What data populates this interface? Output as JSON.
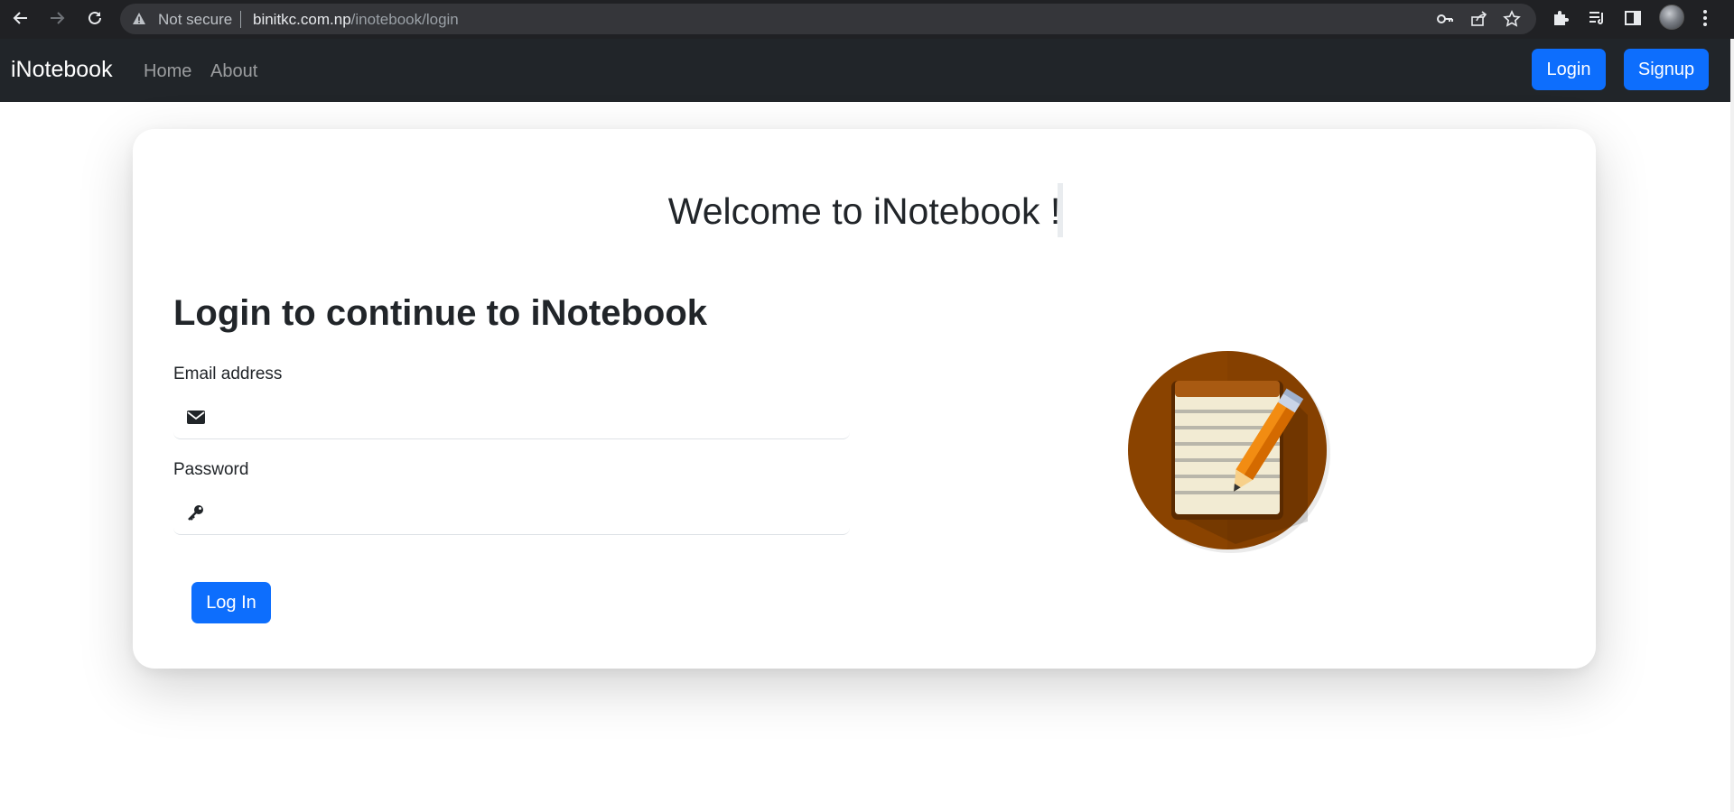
{
  "browser": {
    "security_label": "Not secure",
    "url_host": "binitkc.com.np",
    "url_path": "/inotebook/login"
  },
  "navbar": {
    "brand": "iNotebook",
    "links": [
      "Home",
      "About"
    ],
    "login_label": "Login",
    "signup_label": "Signup"
  },
  "card": {
    "welcome": "Welcome to iNotebook !",
    "heading": "Login to continue to iNotebook",
    "email_label": "Email address",
    "email_value": "",
    "password_label": "Password",
    "password_value": "",
    "submit_label": "Log In"
  },
  "icons": {
    "email": "envelope-icon",
    "password": "key-icon",
    "illustration": "notepad-pencil-icon"
  },
  "colors": {
    "primary": "#0d6efd",
    "navbar_bg": "#212529",
    "chrome_bg": "#202124",
    "illustration_circle": "#8a4300"
  }
}
